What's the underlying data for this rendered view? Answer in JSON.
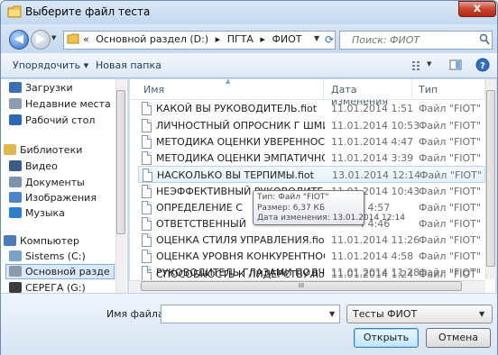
{
  "window": {
    "title": "Выберите файл теста",
    "close_label": "x"
  },
  "address": {
    "chevrons": "«",
    "segments": [
      "Основной раздел (D:)",
      "ПГТА",
      "ФИОТ"
    ],
    "separator": "▸",
    "search_placeholder": "Поиск: ФИОТ"
  },
  "toolbar": {
    "organize_label": "Упорядочить ▾",
    "new_folder_label": "Новая папка"
  },
  "nav": {
    "items": [
      {
        "label": "Загрузки",
        "icon": "downloads-icon",
        "color": "#3d6fb3"
      },
      {
        "label": "Недавние места",
        "icon": "recent-places-icon",
        "color": "#8b9db3"
      },
      {
        "label": "Рабочий стол",
        "icon": "desktop-icon",
        "color": "#2e68b5"
      },
      {
        "label": "Библиотеки",
        "icon": "libraries-icon",
        "color": "#e1b84e"
      },
      {
        "label": "Видео",
        "icon": "video-icon",
        "color": "#3a5d87"
      },
      {
        "label": "Документы",
        "icon": "documents-icon",
        "color": "#7c93b0"
      },
      {
        "label": "Изображения",
        "icon": "pictures-icon",
        "color": "#4c86c6"
      },
      {
        "label": "Музыка",
        "icon": "music-icon",
        "color": "#2d7fd0"
      },
      {
        "label": "Компьютер",
        "icon": "computer-icon",
        "color": "#4a7ab7"
      },
      {
        "label": "Sistems (C:)",
        "icon": "drive-c-icon",
        "color": "#7aa3c9"
      },
      {
        "label": "Основной разде",
        "icon": "drive-d-icon",
        "color": "#8d9aa9"
      },
      {
        "label": "СЕРЕГА (G:)",
        "icon": "drive-g-icon",
        "color": "#3b3b3b"
      }
    ]
  },
  "columns": {
    "name": "Имя",
    "date": "Дата изменения",
    "type": "Тип"
  },
  "files": [
    {
      "name": "КАКОЙ ВЫ РУКОВОДИТЕЛЬ.fiot",
      "date": "11.01.2014 1:51",
      "type": "Файл \"FIOT\""
    },
    {
      "name": "ЛИЧНОСТНЫЙ ОПРОСНИК Г ШМИШЕ...",
      "date": "11.01.2014 10:53",
      "type": "Файл \"FIOT\""
    },
    {
      "name": "МЕТОДИКА ОЦЕНКИ УВЕРЕННОСТИ В ...",
      "date": "11.01.2014 4:47",
      "type": "Файл \"FIOT\""
    },
    {
      "name": "МЕТОДИКА ОЦЕНКИ ЭМПАТИЧНОСТ...",
      "date": "11.01.2014 3:39",
      "type": "Файл \"FIOT\""
    },
    {
      "name": "НАСКОЛЬКО ВЫ ТЕРПИМЫ.fiot",
      "date": "13.01.2014 12:14",
      "type": "Файл \"FIOT\""
    },
    {
      "name": "НЕЭФФЕКТИВНЫЙ РУКОВОДИТЕЛЬ.fiot",
      "date": "11.01.2014 10:43",
      "type": "Файл \"FIOT\""
    },
    {
      "name": "ОПРЕДЕЛЕНИЕ С",
      "date": "4 4:57",
      "type": "Файл \"FIOT\""
    },
    {
      "name": "ОТВЕТСТВЕННЫЙ",
      "date": "4 4:46",
      "type": "Файл \"FIOT\""
    },
    {
      "name": "ОЦЕНКА СТИЛЯ УПРАВЛЕНИЯ.fiot",
      "date": "11.01.2014 11:26",
      "type": "Файл \"FIOT\""
    },
    {
      "name": "ОЦЕНКА УРОВНЯ КОНКУРЕНТНОСПО...",
      "date": "11.01.2014 4:58",
      "type": "Файл \"FIOT\""
    },
    {
      "name": "РУКОВОДИТЕЛЬ ГЛАЗАМИ ПОДЧИНЕ...",
      "date": "11.01.2014 11:28",
      "type": "Файл \"FIOT\""
    },
    {
      "name": "СПОСОБНОСТЬ К ЛИДЕРСТВУ.fiot",
      "date": "11.01.2014 1:24",
      "type": "Файл \"FIOT\""
    }
  ],
  "tooltip": {
    "type_line": "Тип: Файл \"FIOT\"",
    "size_line": "Размер: 6,37 КБ",
    "modified_line": "Дата изменения: 13.01.2014 12:14"
  },
  "footer": {
    "filename_label": "Имя файла:",
    "filename_value": "",
    "filter_value": "Тесты ФИОТ",
    "open_label": "Открыть",
    "cancel_label": "Отмена"
  },
  "hscroll_thumb_label": "III"
}
